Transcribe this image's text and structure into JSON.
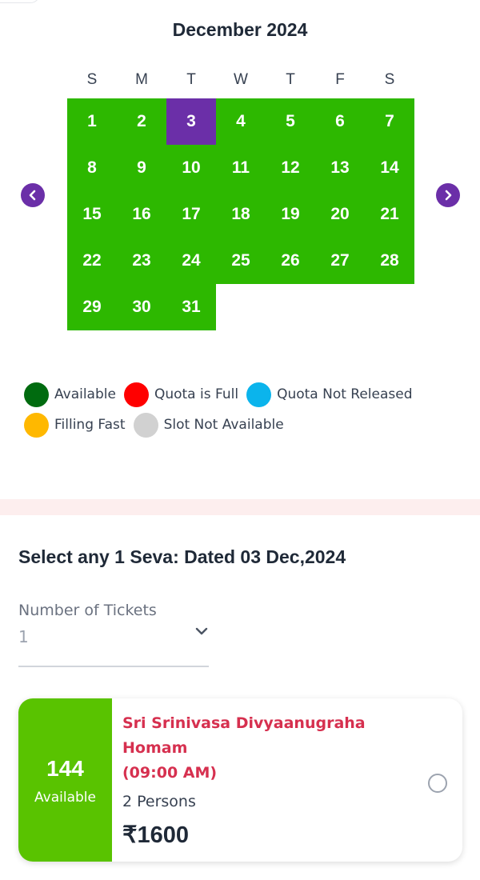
{
  "calendar": {
    "month_title": "December 2024",
    "weekdays": [
      "S",
      "M",
      "T",
      "W",
      "T",
      "F",
      "S"
    ],
    "days": [
      "1",
      "2",
      "3",
      "4",
      "5",
      "6",
      "7",
      "8",
      "9",
      "10",
      "11",
      "12",
      "13",
      "14",
      "15",
      "16",
      "17",
      "18",
      "19",
      "20",
      "21",
      "22",
      "23",
      "24",
      "25",
      "26",
      "27",
      "28",
      "29",
      "30",
      "31"
    ],
    "selected_day": "3",
    "available_color": "#2db800",
    "selected_color": "#6b2fa8",
    "prev_icon": "chevron-left-icon",
    "next_icon": "chevron-right-icon"
  },
  "legend": [
    {
      "label": "Available",
      "color": "#006b0f"
    },
    {
      "label": "Quota is Full",
      "color": "#ff0000"
    },
    {
      "label": "Quota Not Released",
      "color": "#0bb4ec"
    },
    {
      "label": "Filling Fast",
      "color": "#ffb800"
    },
    {
      "label": "Slot Not Available",
      "color": "#d1d1d1"
    }
  ],
  "seva": {
    "heading": "Select any 1 Seva: Dated 03 Dec,2024",
    "tickets_label": "Number of Tickets",
    "tickets_value": "1",
    "card": {
      "available_count": "144",
      "available_label": "Available",
      "name_line1": "Sri Srinivasa Divyaanugraha",
      "name_line2": "Homam",
      "time": "(09:00 AM)",
      "persons": "2 Persons",
      "price": "₹1600",
      "available_color": "#59c300",
      "name_color": "#d6304f"
    }
  }
}
